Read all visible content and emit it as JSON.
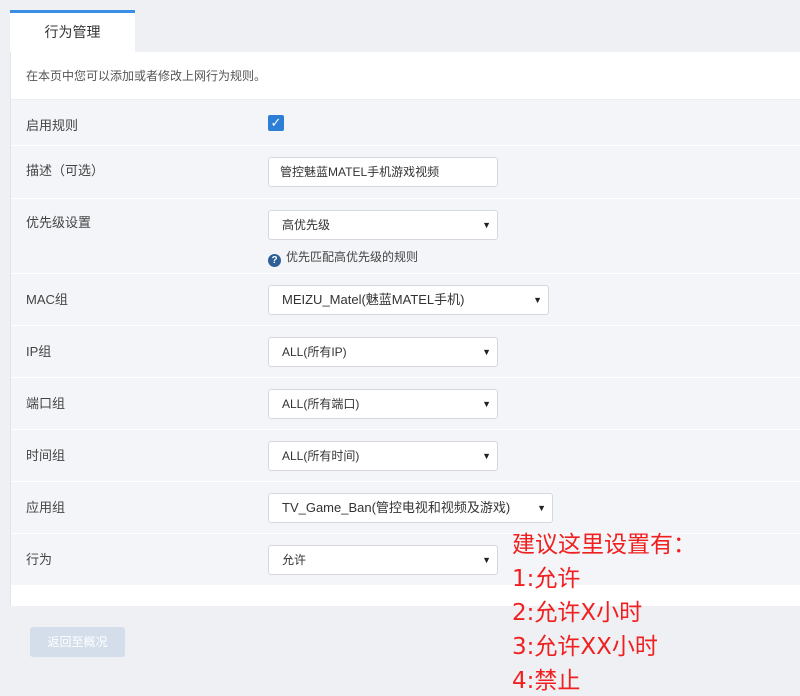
{
  "tab": {
    "label": "行为管理"
  },
  "intro": "在本页中您可以添加或者修改上网行为规则。",
  "form": {
    "enable_rule": {
      "label": "启用规则",
      "checked": true
    },
    "description": {
      "label": "描述（可选）",
      "value": "管控魅蓝MATEL手机游戏视频"
    },
    "priority": {
      "label": "优先级设置",
      "value": "高优先级",
      "hint": "优先匹配高优先级的规则",
      "hint_icon": "help-icon"
    },
    "mac_group": {
      "label": "MAC组",
      "value": "MEIZU_Matel(魅蓝MATEL手机)"
    },
    "ip_group": {
      "label": "IP组",
      "value": "ALL(所有IP)"
    },
    "port_group": {
      "label": "端口组",
      "value": "ALL(所有端口)"
    },
    "time_group": {
      "label": "时间组",
      "value": "ALL(所有时间)"
    },
    "app_group": {
      "label": "应用组",
      "value": "TV_Game_Ban(管控电视和视频及游戏)"
    },
    "action": {
      "label": "行为",
      "value": "允许"
    }
  },
  "back_button": "返回至概况",
  "annotation": {
    "color": "#f02020",
    "lines": [
      "建议这里设置有：",
      "1:允许",
      "2:允许X小时",
      "3:允许XX小时",
      "4:禁止"
    ]
  }
}
